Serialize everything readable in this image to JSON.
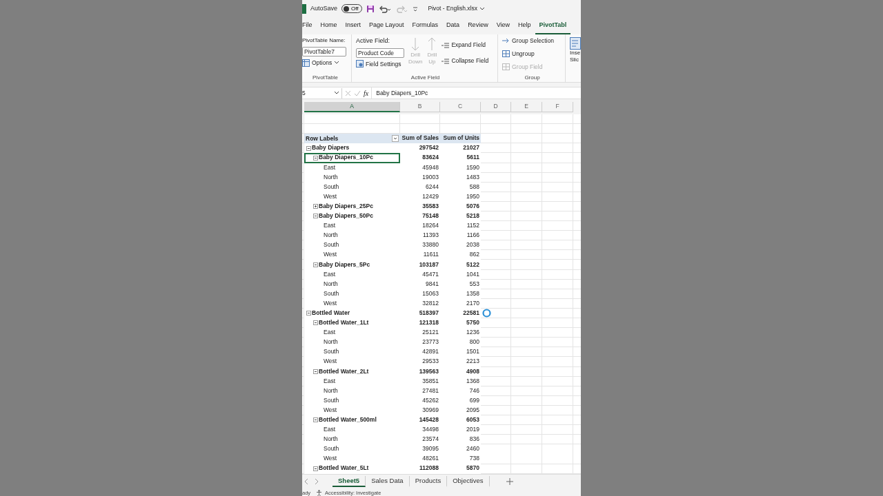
{
  "title_bar": {
    "autosave_label": "AutoSave",
    "autosave": {
      "on": false,
      "label": "Off"
    },
    "file_name": "Pivot - English.xlsx",
    "redo_disabled": true
  },
  "ribbon_tabs": [
    {
      "label": "File",
      "selected": false
    },
    {
      "label": "Home",
      "selected": false
    },
    {
      "label": "Insert",
      "selected": false
    },
    {
      "label": "Page Layout",
      "selected": false
    },
    {
      "label": "Formulas",
      "selected": false
    },
    {
      "label": "Data",
      "selected": false
    },
    {
      "label": "Review",
      "selected": false
    },
    {
      "label": "View",
      "selected": false
    },
    {
      "label": "Help",
      "selected": false
    },
    {
      "label": "PivotTabl",
      "selected": true
    }
  ],
  "ribbon": {
    "pivottable": {
      "name_label": "PivotTable Name:",
      "name_value": "PivotTable7",
      "options": "Options",
      "group_label": "PivotTable"
    },
    "active_field": {
      "field_label": "Active Field:",
      "field_value": "Product Code",
      "field_settings": "Field Settings",
      "drill_down": {
        "lines": [
          "Drill",
          "Down"
        ],
        "disabled": true
      },
      "drill_up": {
        "lines": [
          "Drill",
          "Up"
        ],
        "disabled": true
      },
      "expand": "Expand Field",
      "collapse": "Collapse Field",
      "group_label": "Active Field"
    },
    "group": {
      "items": [
        {
          "label": "Group Selection",
          "disabled": false
        },
        {
          "label": "Ungroup",
          "disabled": false
        },
        {
          "label": "Group Field",
          "disabled": true
        }
      ],
      "group_label": "Group"
    },
    "insert_slicer": [
      "Inse",
      "Slic"
    ]
  },
  "formula_bar": {
    "name_box": "5",
    "function_label": "fx",
    "value": "Baby Diapers_10Pc"
  },
  "columns": [
    {
      "label": "A",
      "selected": true
    },
    {
      "label": "B",
      "selected": false
    },
    {
      "label": "C",
      "selected": false
    },
    {
      "label": "D",
      "selected": false
    },
    {
      "label": "E",
      "selected": false
    },
    {
      "label": "F",
      "selected": false
    }
  ],
  "pivot": {
    "headers": [
      "Row Labels",
      "Sum of Sales",
      "Sum of Units"
    ],
    "rows": [
      {
        "label": "Baby Diapers",
        "sales": "297542",
        "units": "21027",
        "expanded": true,
        "children": [
          {
            "label": "Baby Diapers_10Pc",
            "sales": "83624",
            "units": "5611",
            "expanded": true,
            "selected": true,
            "children": [
              {
                "label": "East",
                "sales": "45948",
                "units": "1590"
              },
              {
                "label": "North",
                "sales": "19003",
                "units": "1483"
              },
              {
                "label": "South",
                "sales": "6244",
                "units": "588"
              },
              {
                "label": "West",
                "sales": "12429",
                "units": "1950"
              }
            ]
          },
          {
            "label": "Baby Diapers_25Pc",
            "sales": "35583",
            "units": "5076",
            "expanded": false,
            "selected": false
          },
          {
            "label": "Baby Diapers_50Pc",
            "sales": "75148",
            "units": "5218",
            "expanded": true,
            "selected": false,
            "children": [
              {
                "label": "East",
                "sales": "18264",
                "units": "1152"
              },
              {
                "label": "North",
                "sales": "11393",
                "units": "1166"
              },
              {
                "label": "South",
                "sales": "33880",
                "units": "2038"
              },
              {
                "label": "West",
                "sales": "11611",
                "units": "862"
              }
            ]
          },
          {
            "label": "Baby Diapers_5Pc",
            "sales": "103187",
            "units": "5122",
            "expanded": true,
            "selected": false,
            "children": [
              {
                "label": "East",
                "sales": "45471",
                "units": "1041"
              },
              {
                "label": "North",
                "sales": "9841",
                "units": "553"
              },
              {
                "label": "South",
                "sales": "15063",
                "units": "1358"
              },
              {
                "label": "West",
                "sales": "32812",
                "units": "2170"
              }
            ]
          }
        ]
      },
      {
        "label": "Bottled Water",
        "sales": "518397",
        "units": "22581",
        "expanded": true,
        "children": [
          {
            "label": "Bottled Water_1Lt",
            "sales": "121318",
            "units": "5750",
            "expanded": true,
            "selected": false,
            "children": [
              {
                "label": "East",
                "sales": "25121",
                "units": "1236"
              },
              {
                "label": "North",
                "sales": "23773",
                "units": "800"
              },
              {
                "label": "South",
                "sales": "42891",
                "units": "1501"
              },
              {
                "label": "West",
                "sales": "29533",
                "units": "2213"
              }
            ]
          },
          {
            "label": "Bottled Water_2Lt",
            "sales": "139563",
            "units": "4908",
            "expanded": true,
            "selected": false,
            "children": [
              {
                "label": "East",
                "sales": "35851",
                "units": "1368"
              },
              {
                "label": "North",
                "sales": "27481",
                "units": "746"
              },
              {
                "label": "South",
                "sales": "45262",
                "units": "699"
              },
              {
                "label": "West",
                "sales": "30969",
                "units": "2095"
              }
            ]
          },
          {
            "label": "Bottled Water_500ml",
            "sales": "145428",
            "units": "6053",
            "expanded": true,
            "selected": false,
            "children": [
              {
                "label": "East",
                "sales": "34498",
                "units": "2019"
              },
              {
                "label": "North",
                "sales": "23574",
                "units": "836"
              },
              {
                "label": "South",
                "sales": "39095",
                "units": "2460"
              },
              {
                "label": "West",
                "sales": "48261",
                "units": "738"
              }
            ]
          },
          {
            "label": "Bottled Water_5Lt",
            "sales": "112088",
            "units": "5870",
            "expanded": true,
            "selected": false
          }
        ]
      }
    ]
  },
  "sheet_tabs": [
    {
      "label": "Sheet5",
      "selected": true
    },
    {
      "label": "Sales Data",
      "selected": false
    },
    {
      "label": "Products",
      "selected": false
    },
    {
      "label": "Objectives",
      "selected": false
    }
  ],
  "status_bar": {
    "mode": "ady",
    "accessibility": "Accessibility: Investigate"
  }
}
